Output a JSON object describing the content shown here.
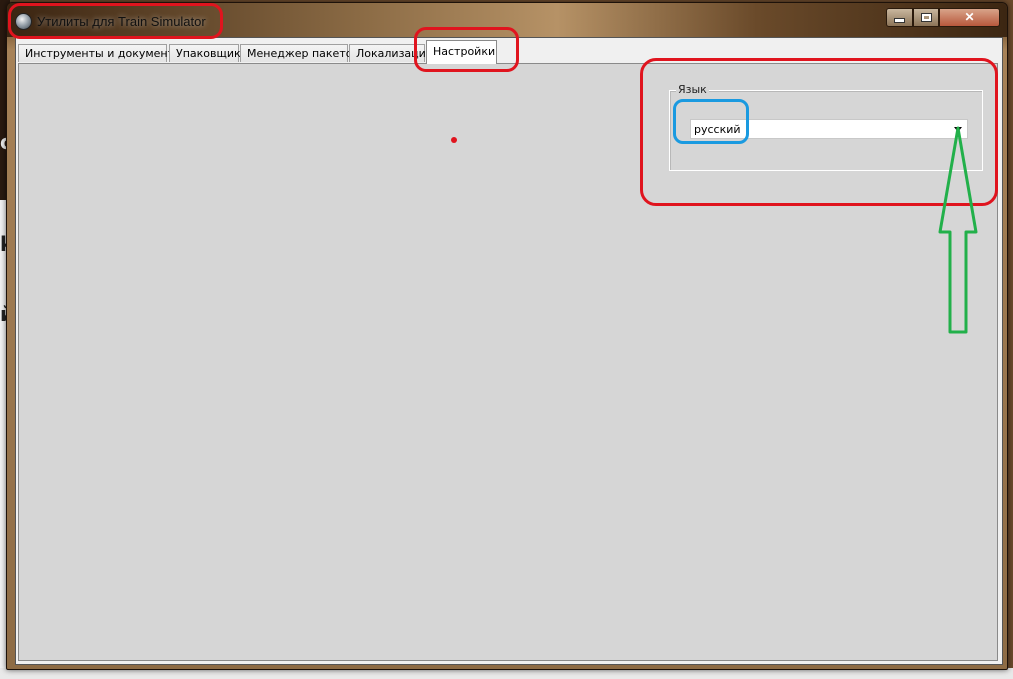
{
  "window": {
    "title": "Утилиты для Train Simulator",
    "controls": {
      "minimize": "minimize",
      "maximize": "maximize",
      "close": "✕"
    }
  },
  "tabs": [
    {
      "label": "Инструменты и документы",
      "active": false
    },
    {
      "label": "Упаковщик",
      "active": false
    },
    {
      "label": "Менеджер пакетов",
      "active": false
    },
    {
      "label": "Локализаци",
      "active": false
    },
    {
      "label": "Настройки",
      "active": true
    }
  ],
  "settings": {
    "language_group_label": "Язык",
    "language_selected": "русский"
  },
  "background_glyphs": [
    "о",
    "k",
    "й"
  ],
  "annotation_colors": {
    "red": "#e0141e",
    "blue": "#1a9ae0",
    "green": "#22b04a"
  },
  "icons": {
    "app": "train-simulator-app-icon",
    "dropdown": "chevron-down-icon",
    "annotation_arrow": "up-arrow-annotation"
  }
}
